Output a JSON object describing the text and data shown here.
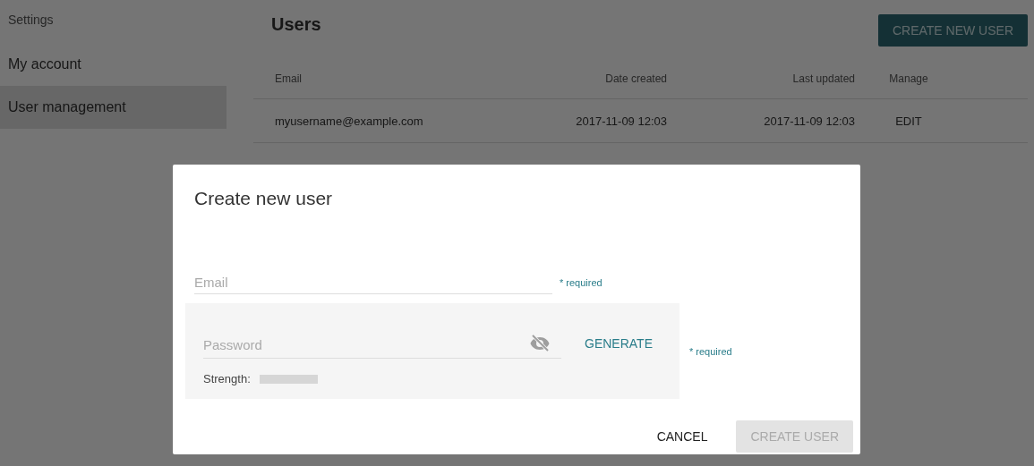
{
  "sidebar": {
    "heading": "Settings",
    "items": [
      {
        "label": "My account",
        "selected": false
      },
      {
        "label": "User management",
        "selected": true
      }
    ]
  },
  "page": {
    "title": "Users",
    "create_button": "CREATE NEW USER"
  },
  "table": {
    "columns": [
      "Email",
      "Date created",
      "Last updated",
      "Manage"
    ],
    "rows": [
      {
        "email": "myusername@example.com",
        "date_created": "2017-11-09 12:03",
        "last_updated": "2017-11-09 12:03",
        "action": "EDIT"
      }
    ]
  },
  "dialog": {
    "title": "Create new user",
    "email": {
      "placeholder": "Email",
      "note": "* required"
    },
    "password": {
      "placeholder": "Password",
      "generate": "GENERATE",
      "note": "* required",
      "strength_label": "Strength:",
      "strength": {
        "level": 0
      }
    },
    "buttons": [
      {
        "label": "CANCEL",
        "kind": "text",
        "disabled": false
      },
      {
        "label": "CREATE USER",
        "kind": "primary",
        "disabled": true
      }
    ]
  }
}
